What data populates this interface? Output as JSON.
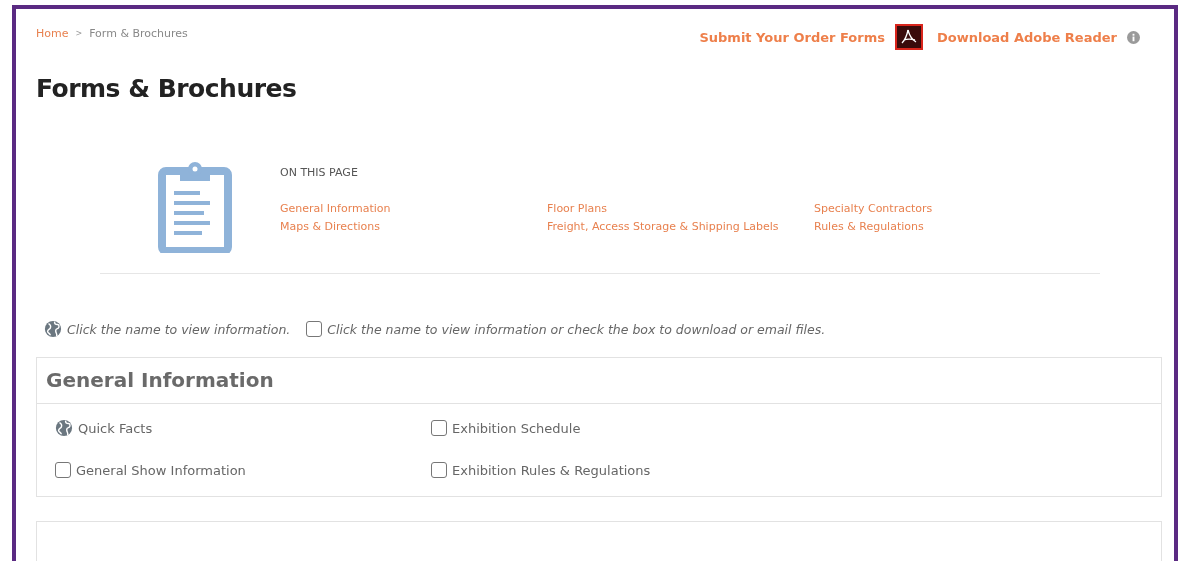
{
  "breadcrumb": {
    "items": [
      "Home",
      "Form & Brochures"
    ],
    "separator": ">"
  },
  "header_links": {
    "submit": "Submit Your Order Forms",
    "download": "Download Adobe Reader"
  },
  "page_title": "Forms & Brochures",
  "on_this_page": {
    "heading": "ON THIS PAGE",
    "columns": [
      [
        "General Information",
        "Maps & Directions"
      ],
      [
        "Floor Plans",
        "Freight, Access Storage & Shipping Labels"
      ],
      [
        "Specialty Contractors",
        "Rules & Regulations"
      ]
    ]
  },
  "legend": [
    {
      "kind": "globe",
      "text": "Click the name to view information."
    },
    {
      "kind": "checkbox",
      "checked": false,
      "text": "Click the name to view information or check the box to download or email files."
    }
  ],
  "sections": [
    {
      "title": "General Information",
      "items": [
        {
          "kind": "globe",
          "label": "Quick Facts"
        },
        {
          "kind": "checkbox",
          "checked": false,
          "label": "Exhibition Schedule"
        },
        {
          "kind": "checkbox",
          "checked": false,
          "label": "General Show Information"
        },
        {
          "kind": "checkbox",
          "checked": false,
          "label": "Exhibition Rules & Regulations"
        }
      ]
    }
  ]
}
